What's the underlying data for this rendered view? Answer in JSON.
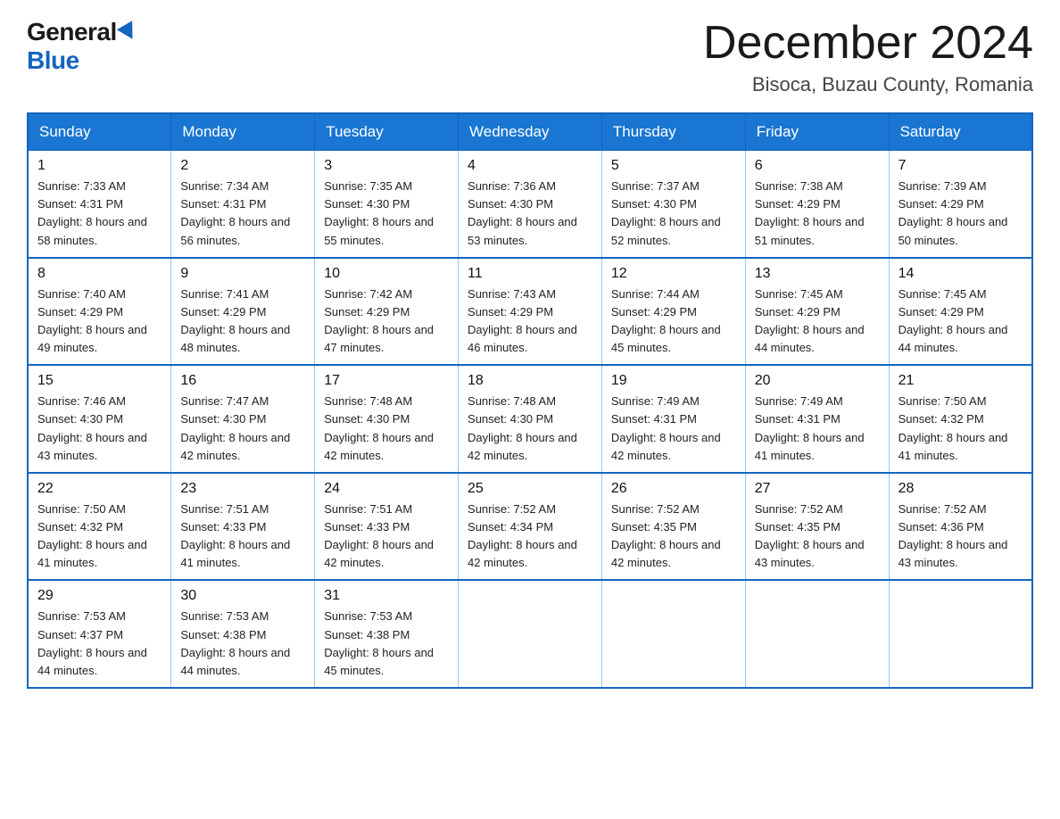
{
  "logo": {
    "general": "General",
    "blue": "Blue"
  },
  "title": "December 2024",
  "location": "Bisoca, Buzau County, Romania",
  "days_of_week": [
    "Sunday",
    "Monday",
    "Tuesday",
    "Wednesday",
    "Thursday",
    "Friday",
    "Saturday"
  ],
  "weeks": [
    [
      {
        "day": "1",
        "sunrise": "7:33 AM",
        "sunset": "4:31 PM",
        "daylight": "8 hours and 58 minutes."
      },
      {
        "day": "2",
        "sunrise": "7:34 AM",
        "sunset": "4:31 PM",
        "daylight": "8 hours and 56 minutes."
      },
      {
        "day": "3",
        "sunrise": "7:35 AM",
        "sunset": "4:30 PM",
        "daylight": "8 hours and 55 minutes."
      },
      {
        "day": "4",
        "sunrise": "7:36 AM",
        "sunset": "4:30 PM",
        "daylight": "8 hours and 53 minutes."
      },
      {
        "day": "5",
        "sunrise": "7:37 AM",
        "sunset": "4:30 PM",
        "daylight": "8 hours and 52 minutes."
      },
      {
        "day": "6",
        "sunrise": "7:38 AM",
        "sunset": "4:29 PM",
        "daylight": "8 hours and 51 minutes."
      },
      {
        "day": "7",
        "sunrise": "7:39 AM",
        "sunset": "4:29 PM",
        "daylight": "8 hours and 50 minutes."
      }
    ],
    [
      {
        "day": "8",
        "sunrise": "7:40 AM",
        "sunset": "4:29 PM",
        "daylight": "8 hours and 49 minutes."
      },
      {
        "day": "9",
        "sunrise": "7:41 AM",
        "sunset": "4:29 PM",
        "daylight": "8 hours and 48 minutes."
      },
      {
        "day": "10",
        "sunrise": "7:42 AM",
        "sunset": "4:29 PM",
        "daylight": "8 hours and 47 minutes."
      },
      {
        "day": "11",
        "sunrise": "7:43 AM",
        "sunset": "4:29 PM",
        "daylight": "8 hours and 46 minutes."
      },
      {
        "day": "12",
        "sunrise": "7:44 AM",
        "sunset": "4:29 PM",
        "daylight": "8 hours and 45 minutes."
      },
      {
        "day": "13",
        "sunrise": "7:45 AM",
        "sunset": "4:29 PM",
        "daylight": "8 hours and 44 minutes."
      },
      {
        "day": "14",
        "sunrise": "7:45 AM",
        "sunset": "4:29 PM",
        "daylight": "8 hours and 44 minutes."
      }
    ],
    [
      {
        "day": "15",
        "sunrise": "7:46 AM",
        "sunset": "4:30 PM",
        "daylight": "8 hours and 43 minutes."
      },
      {
        "day": "16",
        "sunrise": "7:47 AM",
        "sunset": "4:30 PM",
        "daylight": "8 hours and 42 minutes."
      },
      {
        "day": "17",
        "sunrise": "7:48 AM",
        "sunset": "4:30 PM",
        "daylight": "8 hours and 42 minutes."
      },
      {
        "day": "18",
        "sunrise": "7:48 AM",
        "sunset": "4:30 PM",
        "daylight": "8 hours and 42 minutes."
      },
      {
        "day": "19",
        "sunrise": "7:49 AM",
        "sunset": "4:31 PM",
        "daylight": "8 hours and 42 minutes."
      },
      {
        "day": "20",
        "sunrise": "7:49 AM",
        "sunset": "4:31 PM",
        "daylight": "8 hours and 41 minutes."
      },
      {
        "day": "21",
        "sunrise": "7:50 AM",
        "sunset": "4:32 PM",
        "daylight": "8 hours and 41 minutes."
      }
    ],
    [
      {
        "day": "22",
        "sunrise": "7:50 AM",
        "sunset": "4:32 PM",
        "daylight": "8 hours and 41 minutes."
      },
      {
        "day": "23",
        "sunrise": "7:51 AM",
        "sunset": "4:33 PM",
        "daylight": "8 hours and 41 minutes."
      },
      {
        "day": "24",
        "sunrise": "7:51 AM",
        "sunset": "4:33 PM",
        "daylight": "8 hours and 42 minutes."
      },
      {
        "day": "25",
        "sunrise": "7:52 AM",
        "sunset": "4:34 PM",
        "daylight": "8 hours and 42 minutes."
      },
      {
        "day": "26",
        "sunrise": "7:52 AM",
        "sunset": "4:35 PM",
        "daylight": "8 hours and 42 minutes."
      },
      {
        "day": "27",
        "sunrise": "7:52 AM",
        "sunset": "4:35 PM",
        "daylight": "8 hours and 43 minutes."
      },
      {
        "day": "28",
        "sunrise": "7:52 AM",
        "sunset": "4:36 PM",
        "daylight": "8 hours and 43 minutes."
      }
    ],
    [
      {
        "day": "29",
        "sunrise": "7:53 AM",
        "sunset": "4:37 PM",
        "daylight": "8 hours and 44 minutes."
      },
      {
        "day": "30",
        "sunrise": "7:53 AM",
        "sunset": "4:38 PM",
        "daylight": "8 hours and 44 minutes."
      },
      {
        "day": "31",
        "sunrise": "7:53 AM",
        "sunset": "4:38 PM",
        "daylight": "8 hours and 45 minutes."
      },
      null,
      null,
      null,
      null
    ]
  ],
  "colors": {
    "header_bg": "#1976d2",
    "border": "#1565c0",
    "cell_border": "#90caf9"
  }
}
